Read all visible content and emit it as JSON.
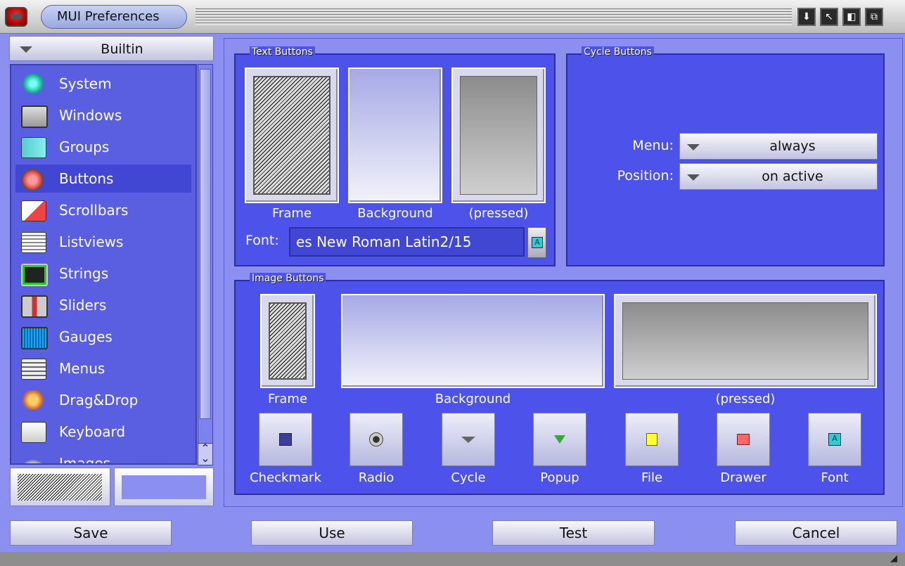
{
  "window": {
    "title": "MUI Preferences"
  },
  "builtin": {
    "label": "Builtin"
  },
  "categories": [
    {
      "label": "System",
      "icon": "butterfly-icon"
    },
    {
      "label": "Windows",
      "icon": "window-icon"
    },
    {
      "label": "Groups",
      "icon": "groups-icon"
    },
    {
      "label": "Buttons",
      "icon": "button-icon",
      "selected": true
    },
    {
      "label": "Scrollbars",
      "icon": "scrollbar-icon"
    },
    {
      "label": "Listviews",
      "icon": "listview-icon"
    },
    {
      "label": "Strings",
      "icon": "string-icon"
    },
    {
      "label": "Sliders",
      "icon": "slider-icon"
    },
    {
      "label": "Gauges",
      "icon": "gauge-icon"
    },
    {
      "label": "Menus",
      "icon": "menu-icon"
    },
    {
      "label": "Drag&Drop",
      "icon": "hand-icon"
    },
    {
      "label": "Keyboard",
      "icon": "keyboard-icon"
    },
    {
      "label": "Images",
      "icon": "images-icon"
    }
  ],
  "text_buttons": {
    "title": "Text Buttons",
    "frame_label": "Frame",
    "background_label": "Background",
    "pressed_label": "(pressed)",
    "font_label": "Font:",
    "font_value": "es New Roman Latin2/15"
  },
  "cycle_buttons": {
    "title": "Cycle Buttons",
    "menu_label": "Menu:",
    "menu_value": "always",
    "position_label": "Position:",
    "position_value": "on active"
  },
  "image_buttons": {
    "title": "Image Buttons",
    "frame_label": "Frame",
    "background_label": "Background",
    "pressed_label": "(pressed)",
    "images": [
      {
        "label": "Checkmark",
        "icon": "checkmark-icon"
      },
      {
        "label": "Radio",
        "icon": "radio-icon"
      },
      {
        "label": "Cycle",
        "icon": "cycle-icon"
      },
      {
        "label": "Popup",
        "icon": "popup-icon"
      },
      {
        "label": "File",
        "icon": "file-icon"
      },
      {
        "label": "Drawer",
        "icon": "drawer-icon"
      },
      {
        "label": "Font",
        "icon": "font-icon"
      }
    ]
  },
  "buttons": {
    "save": "Save",
    "use": "Use",
    "test": "Test",
    "cancel": "Cancel"
  },
  "colors": {
    "background": "#8b8ff0",
    "group": "#4c52ea",
    "list": "#5a5fe2"
  }
}
